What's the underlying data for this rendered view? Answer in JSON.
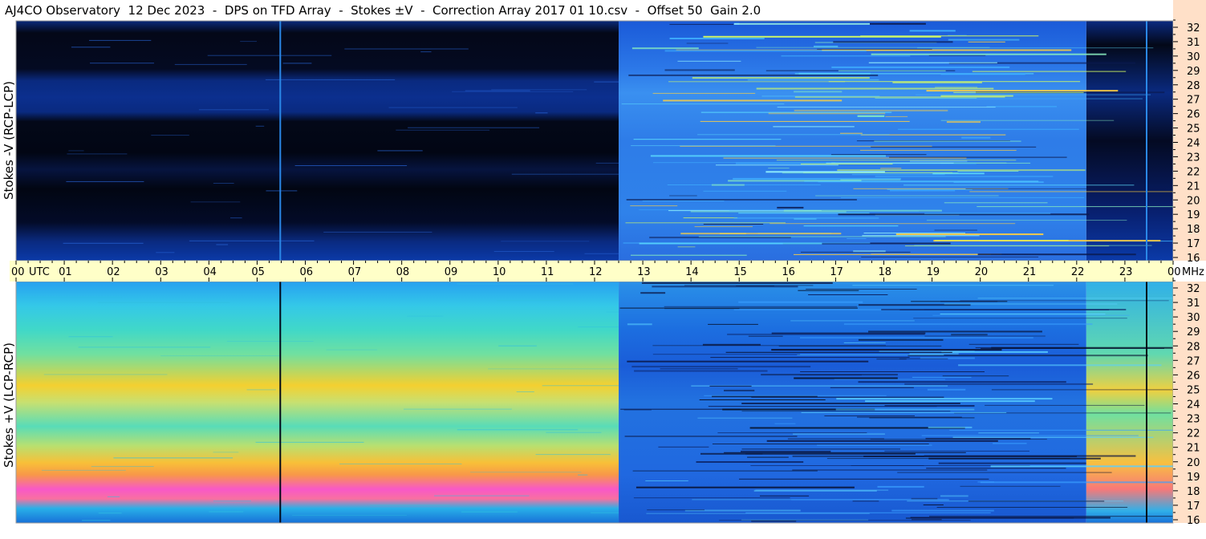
{
  "title": "AJ4CO Observatory  12 Dec 2023  -  DPS on TFD Array  -  Stokes ±V  -  Correction Array 2017 01 10.csv  -  Offset 50  Gain 2.0",
  "colors": {
    "time_axis_bg": "#ffffc8",
    "freq_axis_bg": "#ffe0c8"
  },
  "chart_data": [
    {
      "type": "heatmap",
      "name": "top",
      "ylabel": "Stokes -V (RCP-LCP)",
      "xlabel": "UTC",
      "x_ticks": [
        "00",
        "01",
        "02",
        "03",
        "04",
        "05",
        "06",
        "07",
        "08",
        "09",
        "10",
        "11",
        "12",
        "13",
        "14",
        "15",
        "16",
        "17",
        "18",
        "19",
        "20",
        "21",
        "22",
        "23",
        "00"
      ],
      "x_unit": "UTC",
      "xlim": [
        0,
        24
      ],
      "y_ticks": [
        "16",
        "17",
        "18",
        "19",
        "20",
        "21",
        "22",
        "23",
        "24",
        "25",
        "26",
        "27",
        "28",
        "29",
        "30",
        "31",
        "32"
      ],
      "y_unit": "MHz",
      "ylim": [
        16,
        32
      ],
      "description_features": {
        "vertical_line_utc": [
          5.48,
          23.45
        ],
        "regime_change_utc": 12.5
      }
    },
    {
      "type": "heatmap",
      "name": "bottom",
      "ylabel": "Stokes +V (LCP-RCP)",
      "xlabel": "UTC",
      "x_ticks": [
        "00",
        "01",
        "02",
        "03",
        "04",
        "05",
        "06",
        "07",
        "08",
        "09",
        "10",
        "11",
        "12",
        "13",
        "14",
        "15",
        "16",
        "17",
        "18",
        "19",
        "20",
        "21",
        "22",
        "23",
        "00"
      ],
      "x_unit": "UTC",
      "xlim": [
        0,
        24
      ],
      "y_ticks": [
        "16",
        "17",
        "18",
        "19",
        "20",
        "21",
        "22",
        "23",
        "24",
        "25",
        "26",
        "27",
        "28",
        "29",
        "30",
        "31",
        "32"
      ],
      "y_unit": "MHz",
      "ylim": [
        16,
        32
      ],
      "description_features": {
        "vertical_line_utc": [
          5.48,
          23.45
        ],
        "regime_change_utc": 12.5
      }
    }
  ]
}
